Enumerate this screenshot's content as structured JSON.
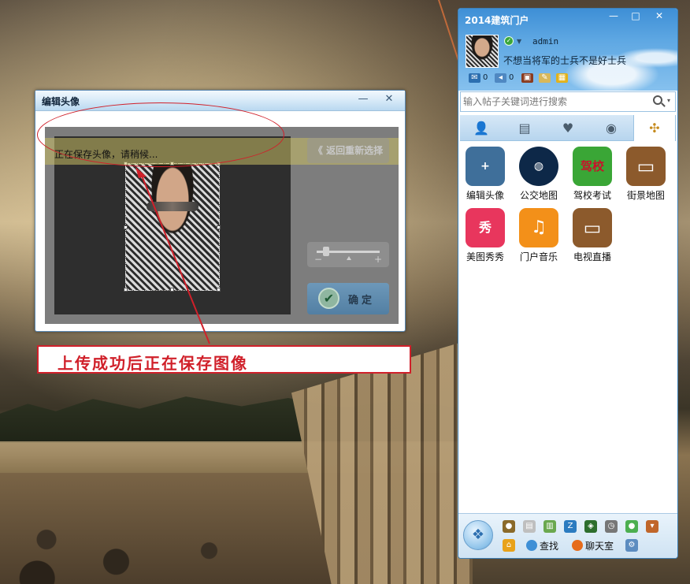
{
  "edit_window": {
    "title": "编辑头像",
    "minimize_glyph": "—",
    "close_glyph": "✕",
    "saving_text": "正在保存头像，请稍候...",
    "back_button": "《 返回重新选择",
    "slider_minus": "−",
    "slider_plus": "+",
    "ok_icon_glyph": "✔",
    "ok_button": "确定"
  },
  "annotation": {
    "callout_text": "上传成功后正在保存图像"
  },
  "panel": {
    "title": "2014建筑门户",
    "minimize_glyph": "—",
    "maximize_glyph": "□",
    "close_glyph": "✕",
    "status_glyph": "✓",
    "status_caret": "▼",
    "username": "admin",
    "signature": "不想当将军的士兵不是好士兵",
    "mail_count": "0",
    "sound_count": "0",
    "search_placeholder": "输入帖子关键词进行搜索",
    "search_caret": "▾",
    "tabs": [
      {
        "icon": "👤"
      },
      {
        "icon": "▤"
      },
      {
        "icon": "♥"
      },
      {
        "icon": "◉"
      },
      {
        "icon": "✣"
      }
    ],
    "apps": [
      {
        "label": "编辑头像",
        "icon_text": "+",
        "color": "#3f6f9a"
      },
      {
        "label": "公交地图",
        "icon_text": "◍",
        "color": "#0d2848"
      },
      {
        "label": "驾校考试",
        "icon_text": "驾校",
        "color": "#3aa636"
      },
      {
        "label": "街景地图",
        "icon_text": "▭",
        "color": "#8c5a2c"
      },
      {
        "label": "美图秀秀",
        "icon_text": "秀",
        "color": "#e8365d"
      },
      {
        "label": "门户音乐",
        "icon_text": "♫",
        "color": "#f39019"
      },
      {
        "label": "电视直播",
        "icon_text": "▭",
        "color": "#8c5a2c"
      }
    ],
    "main_menu_glyph": "❖",
    "bottom_links": {
      "find": "查找",
      "chat": "聊天室"
    },
    "colors": {
      "accent_blue": "#3e8fd6",
      "annotation_red": "#d0202a"
    }
  }
}
